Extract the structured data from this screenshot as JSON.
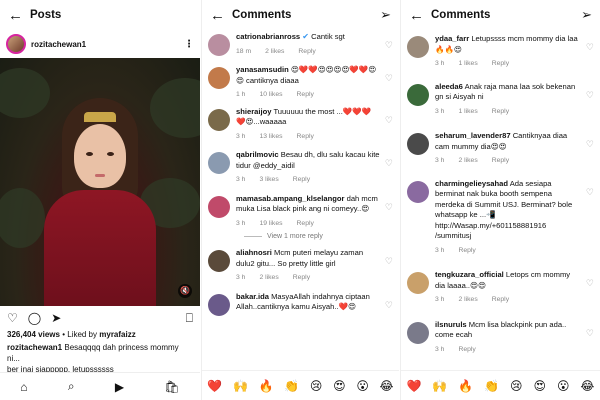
{
  "post": {
    "header_title": "Posts",
    "username": "rozitachewan1",
    "likes_count": "326,404",
    "likes_label": "views",
    "liked_by_prefix": "• Liked by",
    "liked_by": "myrafaizz",
    "caption_user": "rozitachewan1",
    "caption_text": "Besaqqqq dah princess mommy ni...",
    "caption_more": "ber inai siappppp, letupssssss"
  },
  "comments_a": {
    "header_title": "Comments",
    "view_more": "View 1 more reply",
    "items": [
      {
        "user": "catrionabrianross",
        "verified": "✔",
        "text": "Cantik sgt",
        "time": "18 m",
        "likes": "2 likes",
        "reply": "Reply",
        "color": "#b98ea0"
      },
      {
        "user": "yanasamsudin",
        "text": "😍❤️❤️😍😍😍😍❤️❤️😍😍 cantiknya diaaa",
        "time": "1 h",
        "likes": "10 likes",
        "reply": "Reply",
        "color": "#c27a4a"
      },
      {
        "user": "shieraijoy",
        "text": "Tuuuuuu the most ...❤️❤️❤️ ❤️😍...waaaaa",
        "time": "3 h",
        "likes": "13 likes",
        "reply": "Reply",
        "color": "#7a6a4a"
      },
      {
        "user": "qabrilmovic",
        "text": "Besau dh, dlu salu kacau kite tidur @eddy_aidil",
        "time": "3 h",
        "likes": "3 likes",
        "reply": "Reply",
        "color": "#8a9ab0"
      },
      {
        "user": "mamasab.ampang_klselangor",
        "text": "dah mcm muka Lisa black pink ang ni comeyy..😍",
        "time": "3 h",
        "likes": "19 likes",
        "reply": "Reply",
        "color": "#c04a6a"
      },
      {
        "user": "aliahnosri",
        "text": "Mcm puteri melayu zaman dulu2 gitu... So pretty little girl",
        "time": "3 h",
        "likes": "2 likes",
        "reply": "Reply",
        "color": "#5a4a3a"
      },
      {
        "user": "bakar.ida",
        "text": "MasyaAllah indahnya ciptaan Allah..cantiknya kamu Aisyah..❤️😍",
        "time": "",
        "likes": "",
        "reply": "",
        "color": "#6a5a8a"
      }
    ],
    "emojis": [
      "❤️",
      "🙌",
      "🔥",
      "👏",
      "😢",
      "😍",
      "😮",
      "😂"
    ]
  },
  "comments_b": {
    "header_title": "Comments",
    "items": [
      {
        "user": "ydaa_farr",
        "text": "Letupssss mcm mommy dia laa🔥🔥😍",
        "time": "3 h",
        "likes": "1 likes",
        "reply": "Reply",
        "color": "#9a8a7a"
      },
      {
        "user": "aleeda6",
        "text": "Anak raja mana laa sok bekenan gn si Aisyah ni",
        "time": "3 h",
        "likes": "1 likes",
        "reply": "Reply",
        "color": "#3a6a3a"
      },
      {
        "user": "seharum_lavender87",
        "text": "Cantiknyaa diaa cam mummy dia😍😍",
        "time": "3 h",
        "likes": "2 likes",
        "reply": "Reply",
        "color": "#4a4a4a"
      },
      {
        "user": "charmingelieysahad",
        "text": "Ada sesiapa berminat nak buka booth sempena merdeka di Summit USJ. Berminat? bole whatsapp ke ...📲 http://Wasap.my/+601158881916 /summitusj",
        "time": "3 h",
        "likes": "",
        "reply": "Reply",
        "color": "#8a6aa0"
      },
      {
        "user": "tengkuzara_official",
        "text": "Letops cm mommy dia laaaa..😍😍",
        "time": "3 h",
        "likes": "2 likes",
        "reply": "Reply",
        "color": "#c9a06a"
      },
      {
        "user": "ilsnuruls",
        "text": "Mcm lisa blackpink pun ada.. come ecah",
        "time": "3 h",
        "likes": "",
        "reply": "Reply",
        "color": "#7a7a8a"
      }
    ],
    "emojis": [
      "❤️",
      "🙌",
      "🔥",
      "👏",
      "😢",
      "😍",
      "😮",
      "😂"
    ]
  }
}
